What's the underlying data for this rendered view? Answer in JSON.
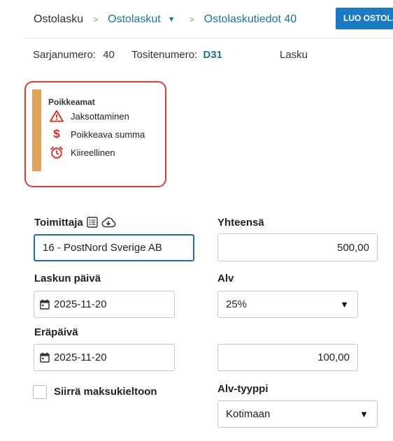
{
  "breadcrumb": {
    "home": "Ostolasku",
    "sep1": ">",
    "section": "Ostolaskut",
    "sep2": ">",
    "current": "Ostolaskutiedot 40"
  },
  "header": {
    "create_button": "LUO OSTOLASKU"
  },
  "meta": {
    "series_label": "Sarjanumero:",
    "series_value": "40",
    "voucher_label": "Tositenumero:",
    "voucher_value": "D31",
    "type": "Lasku"
  },
  "deviations": {
    "title": "Poikkeamat",
    "accent_color": "#dfa35a",
    "border_color": "#e23b2a",
    "items": [
      {
        "icon": "warning-icon",
        "label": "Jaksottaminen"
      },
      {
        "icon": "dollar-icon",
        "label": "Poikkeava summa"
      },
      {
        "icon": "alarm-clock-icon",
        "label": "Kiireellinen"
      }
    ]
  },
  "form": {
    "supplier": {
      "label": "Toimittaja",
      "value": "16 - PostNord Sverige AB"
    },
    "total": {
      "label": "Yhteensä",
      "value": "500,00"
    },
    "invoice_date": {
      "label": "Laskun päivä",
      "value": "2025-11-20"
    },
    "vat": {
      "label": "Alv",
      "value": "25%"
    },
    "due_date": {
      "label": "Eräpäivä",
      "value": "2025-11-20"
    },
    "vat_amount": {
      "value": "100,00"
    },
    "payment_block": {
      "label": "Siirrä maksukieltoon",
      "checked": false
    },
    "vat_type": {
      "label": "Alv-tyyppi",
      "value": "Kotimaan"
    }
  },
  "colors": {
    "link": "#1a73a8",
    "primary_button": "#1a7bc4",
    "focus_border": "#1a6fa8"
  }
}
